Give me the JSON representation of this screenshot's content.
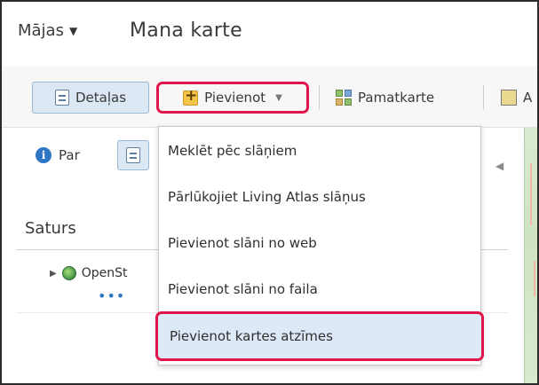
{
  "header": {
    "home_label": "Mājas",
    "map_title": "Mana karte"
  },
  "toolbar": {
    "details_label": "Detaļas",
    "add_label": "Pievienot",
    "basemap_label": "Pamatkarte",
    "analysis_label": "A"
  },
  "panel": {
    "about_label": "Par",
    "content_title": "Saturs",
    "layer_name": "OpenSt",
    "layer_more": "•••"
  },
  "add_menu": {
    "items": [
      {
        "label": "Meklēt pēc slāņiem",
        "highlighted": false
      },
      {
        "label": "Pārlūkojiet Living Atlas slāņus",
        "highlighted": false
      },
      {
        "label": "Pievienot slāni no web",
        "highlighted": false
      },
      {
        "label": "Pievienot slāni no faila",
        "highlighted": false
      },
      {
        "label": "Pievienot kartes atzīmes",
        "highlighted": true
      }
    ]
  },
  "colors": {
    "highlight_outline": "#e0154a",
    "selected_fill": "#dbe7f3",
    "info_blue": "#2f77c5"
  },
  "icons": {
    "details": "document-icon",
    "add": "add-plus-icon",
    "basemap": "basemap-grid-icon",
    "about": "info-icon",
    "layer": "globe-icon"
  }
}
